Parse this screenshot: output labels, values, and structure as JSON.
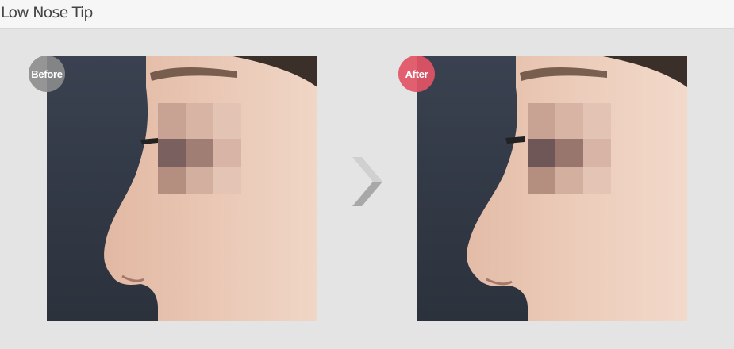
{
  "page": {
    "title": "Low Nose Tip"
  },
  "photos": {
    "before": {
      "badge_label": "Before",
      "badge_color": "#8c8c8c"
    },
    "after": {
      "badge_label": "After",
      "badge_color": "#e25465"
    }
  },
  "icons": {
    "arrow": "chevron-right-icon"
  }
}
